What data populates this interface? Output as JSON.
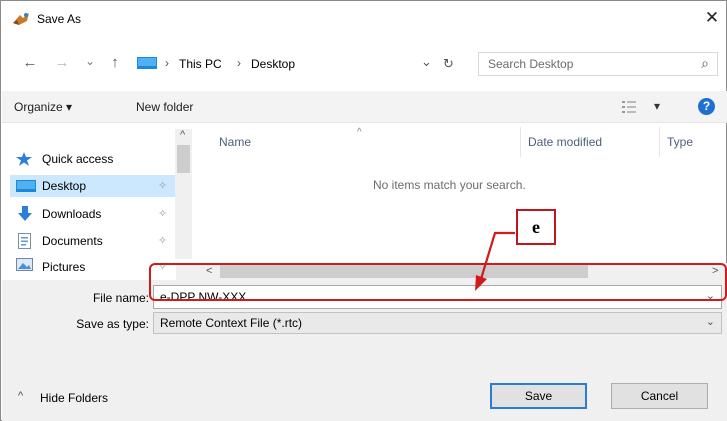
{
  "window": {
    "title": "Save As",
    "close_glyph": "✕"
  },
  "nav": {
    "back_glyph": "←",
    "forward_glyph": "→",
    "recent_glyph": "⌄",
    "up_glyph": "↑",
    "breadcrumb": [
      "This PC",
      "Desktop"
    ],
    "breadcrumb_sep": "›",
    "dropdown_glyph": "⌄",
    "refresh_glyph": "↻",
    "search_placeholder": "Search Desktop",
    "search_glyph": "⌕"
  },
  "toolbar": {
    "organize_label": "Organize ▾",
    "new_folder_label": "New folder",
    "view_dropdown": "▾",
    "help_glyph": "?"
  },
  "navpane": {
    "items": [
      {
        "label": "Quick access",
        "icon": "star-icon"
      },
      {
        "label": "Desktop",
        "icon": "desktop-icon",
        "pin": "✧",
        "selected": true
      },
      {
        "label": "Downloads",
        "icon": "download-icon",
        "pin": "✧"
      },
      {
        "label": "Documents",
        "icon": "documents-icon",
        "pin": "✧"
      },
      {
        "label": "Pictures",
        "icon": "pictures-icon",
        "pin": "✧"
      }
    ],
    "scroll_up": "^",
    "scroll_down": "v"
  },
  "filelist": {
    "columns": [
      "Name",
      "Date modified",
      "Type"
    ],
    "sort_glyph": "^",
    "empty_message": "No items match your search.",
    "scroll_left": "<",
    "scroll_right": ">"
  },
  "form": {
    "file_name_label": "File name:",
    "file_name_value": "e-DPP NW-XXX",
    "save_type_label": "Save as type:",
    "save_type_value": "Remote Context File (*.rtc)",
    "dropdown_glyph": "⌄"
  },
  "footer": {
    "hide_folders_label": "Hide Folders",
    "hide_folders_glyph": "^",
    "save_label": "Save",
    "cancel_label": "Cancel"
  },
  "annotation": {
    "callout_label": "e",
    "color": "#d11a1a"
  }
}
